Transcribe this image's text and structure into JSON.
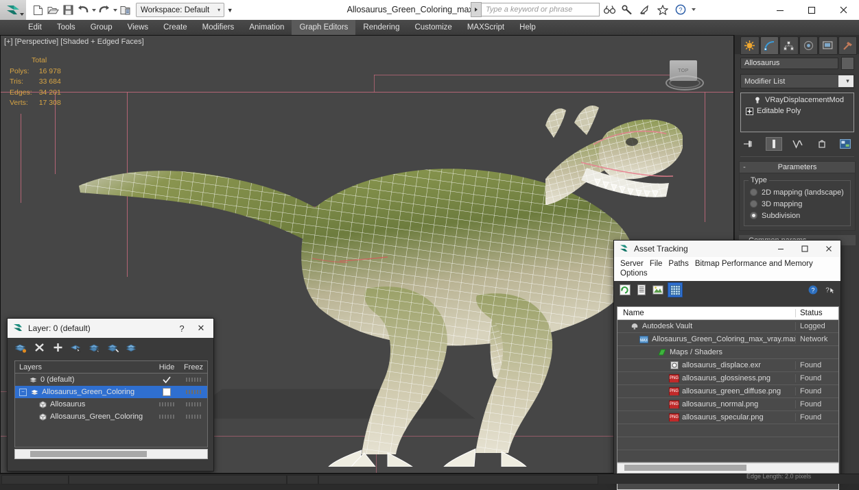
{
  "titlebar": {
    "document_title": "Allosaurus_Green_Coloring_max_vray.max",
    "workspace_label": "Workspace: Default",
    "search_placeholder": "Type a keyword or phrase",
    "quick_access": [
      {
        "name": "new-file-button",
        "icon": "new-file-icon"
      },
      {
        "name": "open-file-button",
        "icon": "open-folder-icon"
      },
      {
        "name": "save-file-button",
        "icon": "save-disk-icon"
      },
      {
        "name": "undo-button",
        "icon": "undo-arrow-icon"
      },
      {
        "name": "redo-button",
        "icon": "redo-arrow-icon"
      },
      {
        "name": "project-folder-button",
        "icon": "project-folder-icon"
      }
    ],
    "title_icons": [
      "binoculars-icon",
      "wrench-icon",
      "satellite-icon",
      "star-icon",
      "help-icon"
    ],
    "window_buttons": [
      "minimize",
      "maximize",
      "close"
    ]
  },
  "menubar": {
    "items": [
      "Edit",
      "Tools",
      "Group",
      "Views",
      "Create",
      "Modifiers",
      "Animation",
      "Graph Editors",
      "Rendering",
      "Customize",
      "MAXScript",
      "Help"
    ]
  },
  "viewport": {
    "label": "[+] [Perspective] [Shaded + Edged Faces]",
    "stats": {
      "header": "Total",
      "rows": [
        {
          "label": "Polys:",
          "value": "16 978"
        },
        {
          "label": "Tris:",
          "value": "33 684"
        },
        {
          "label": "Edges:",
          "value": "34 201"
        },
        {
          "label": "Verts:",
          "value": "17 308"
        }
      ]
    },
    "viewcube_label": "TOP",
    "stats_color": "#d8a544",
    "grid_color": "#c86b7e"
  },
  "command_panel": {
    "tabs": [
      "create-tab",
      "modify-tab",
      "hierarchy-tab",
      "motion-tab",
      "display-tab",
      "utilities-tab"
    ],
    "active_tab_index": 1,
    "object_name": "Allosaurus",
    "modifier_list_label": "Modifier List",
    "stack": [
      {
        "label": "VRayDisplacementMod",
        "icon": "lightbulb-icon",
        "indented": true
      },
      {
        "label": "Editable Poly",
        "icon": "plus-box-icon",
        "indented": false
      }
    ],
    "stack_buttons": [
      "pin-stack-icon",
      "show-end-result-icon",
      "make-unique-icon",
      "remove-modifier-icon",
      "configure-sets-icon"
    ],
    "rollout": {
      "title": "Parameters",
      "minus": "-",
      "group_label": "Type",
      "options": [
        {
          "label": "2D mapping (landscape)",
          "selected": false
        },
        {
          "label": "3D mapping",
          "selected": false
        },
        {
          "label": "Subdivision",
          "selected": true
        }
      ]
    },
    "next_rollout": "Common params"
  },
  "layer_dialog": {
    "title": "Layer: 0 (default)",
    "help_button": "?",
    "close_button": "✕",
    "toolbar": [
      "new-layer-icon",
      "delete-layer-icon",
      "add-layer-icon",
      "select-objects-icon",
      "select-highlight-icon",
      "add-selection-icon",
      "layer-properties-icon"
    ],
    "columns": {
      "name": "Layers",
      "hide": "Hide",
      "freeze": "Freez"
    },
    "rows": [
      {
        "label": "0 (default)",
        "indent": 1,
        "selected": false,
        "current": true,
        "checkbox": false
      },
      {
        "label": "Allosaurus_Green_Coloring",
        "indent": 0,
        "selected": true,
        "current": false,
        "checkbox": true
      },
      {
        "label": "Allosaurus",
        "indent": 2,
        "selected": false,
        "current": false,
        "checkbox": false
      },
      {
        "label": "Allosaurus_Green_Coloring",
        "indent": 2,
        "selected": false,
        "current": false,
        "checkbox": false
      }
    ],
    "selection_color": "#2f6fd0"
  },
  "asset_tracking": {
    "title": "Asset Tracking",
    "menu": [
      "Server",
      "File",
      "Paths",
      "Bitmap Performance and Memory",
      "Options"
    ],
    "toolbar": [
      "refresh-icon",
      "list-view-icon",
      "bitmap-view-icon",
      "table-view-icon"
    ],
    "toolbar_right": [
      "help-icon",
      "help-arrow-icon"
    ],
    "active_toolbar_index": 3,
    "columns": {
      "name": "Name",
      "status": "Status"
    },
    "rows": [
      {
        "name": "Autodesk Vault",
        "status": "Logged",
        "indent": 0,
        "icon": "vault-icon"
      },
      {
        "name": "Allosaurus_Green_Coloring_max_vray.max",
        "status": "Network",
        "indent": 1,
        "icon": "max-file-icon"
      },
      {
        "name": "Maps / Shaders",
        "status": "",
        "indent": 2,
        "icon": "maps-icon"
      },
      {
        "name": "allosaurus_displace.exr",
        "status": "Found",
        "indent": 3,
        "icon": "exr-file-icon"
      },
      {
        "name": "allosaurus_glossiness.png",
        "status": "Found",
        "indent": 3,
        "icon": "png-file-icon"
      },
      {
        "name": "allosaurus_green_diffuse.png",
        "status": "Found",
        "indent": 3,
        "icon": "png-file-icon"
      },
      {
        "name": "allosaurus_normal.png",
        "status": "Found",
        "indent": 3,
        "icon": "png-file-icon"
      },
      {
        "name": "allosaurus_specular.png",
        "status": "Found",
        "indent": 3,
        "icon": "png-file-icon"
      }
    ],
    "png_badge_text": "PNG"
  },
  "status_bar": {
    "edge_length": "Edge Length: 2.0    pixels"
  }
}
